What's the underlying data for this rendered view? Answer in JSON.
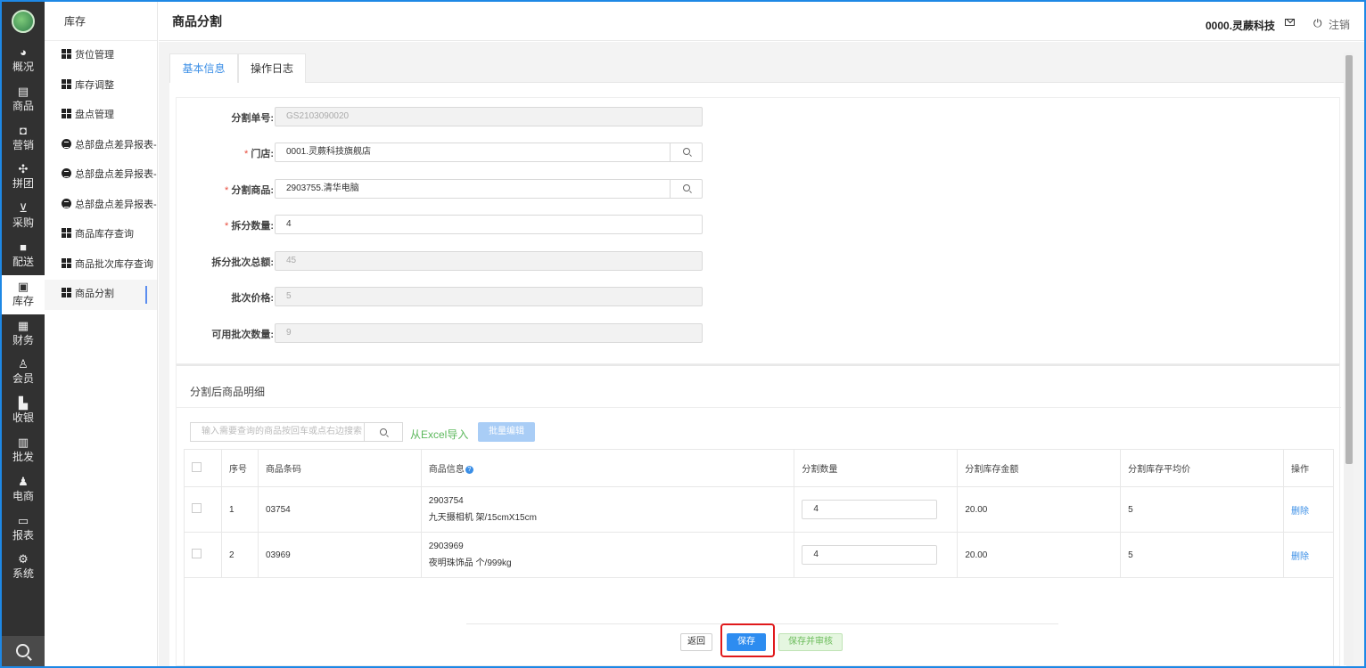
{
  "rail": {
    "items": [
      {
        "label": "概况",
        "icon": "dashboard-icon",
        "glyph": "◕"
      },
      {
        "label": "商品",
        "icon": "document-icon",
        "glyph": "▤"
      },
      {
        "label": "营销",
        "icon": "bag-icon",
        "glyph": "◘"
      },
      {
        "label": "拼团",
        "icon": "cluster-icon",
        "glyph": "✣"
      },
      {
        "label": "采购",
        "icon": "cart-icon",
        "glyph": "⊻"
      },
      {
        "label": "配送",
        "icon": "truck-icon",
        "glyph": "■"
      },
      {
        "label": "库存",
        "icon": "box-icon",
        "glyph": "▣"
      },
      {
        "label": "财务",
        "icon": "money-icon",
        "glyph": "▦"
      },
      {
        "label": "会员",
        "icon": "user-icon",
        "glyph": "♙"
      },
      {
        "label": "收银",
        "icon": "register-icon",
        "glyph": "▙"
      },
      {
        "label": "批发",
        "icon": "clipboard-icon",
        "glyph": "▥"
      },
      {
        "label": "电商",
        "icon": "person-icon",
        "glyph": "♟"
      },
      {
        "label": "报表",
        "icon": "monitor-icon",
        "glyph": "▭"
      },
      {
        "label": "系统",
        "icon": "gear-icon",
        "glyph": "⚙"
      }
    ],
    "active_index": 6
  },
  "submenu": {
    "title": "库存",
    "items": [
      {
        "label": "货位管理",
        "icon": "grid-icon"
      },
      {
        "label": "库存调整",
        "icon": "grid-icon"
      },
      {
        "label": "盘点管理",
        "icon": "grid-icon"
      },
      {
        "label": "总部盘点差异报表-...",
        "icon": "database-icon"
      },
      {
        "label": "总部盘点差异报表-...",
        "icon": "database-icon"
      },
      {
        "label": "总部盘点差异报表-...",
        "icon": "database-icon"
      },
      {
        "label": "商品库存查询",
        "icon": "grid-icon"
      },
      {
        "label": "商品批次库存查询",
        "icon": "grid-icon"
      },
      {
        "label": "商品分割",
        "icon": "grid-icon"
      }
    ],
    "active_index": 8
  },
  "header": {
    "title": "商品分割",
    "company": "0000.灵蕨科技",
    "logout": "注销",
    "power_glyph": "⏻"
  },
  "tabs": [
    "基本信息",
    "操作日志"
  ],
  "form": {
    "split_no": {
      "label": "分割单号:",
      "value": "GS2103090020"
    },
    "store": {
      "label": "门店:",
      "value": "0001.灵蕨科技旗舰店"
    },
    "split_item": {
      "label": "分割商品:",
      "value": "2903755.清华电脑"
    },
    "split_qty": {
      "label": "拆分数量:",
      "value": "4"
    },
    "batch_total": {
      "label": "拆分批次总额:",
      "value": "45"
    },
    "batch_price": {
      "label": "批次价格:",
      "value": "5"
    },
    "available_qty": {
      "label": "可用批次数量:",
      "value": "9"
    }
  },
  "detail": {
    "title": "分割后商品明细",
    "search_placeholder": "输入需要查询的商品按回车或点右边搜索",
    "excel_import": "从Excel导入",
    "batch_edit": "批量编辑",
    "columns": [
      "序号",
      "商品条码",
      "商品信息",
      "分割数量",
      "分割库存金额",
      "分割库存平均价",
      "操作"
    ],
    "rows": [
      {
        "seq": "1",
        "barcode": "03754",
        "code": "2903754",
        "desc": "九天摄相机 架/15cmX15cm",
        "qty": "4",
        "amount": "20.00",
        "avg": "5",
        "action": "删除"
      },
      {
        "seq": "2",
        "barcode": "03969",
        "code": "2903969",
        "desc": "夜明珠饰品 个/999kg",
        "qty": "4",
        "amount": "20.00",
        "avg": "5",
        "action": "删除"
      }
    ]
  },
  "footer": {
    "back": "返回",
    "save": "保存",
    "save_audit": "保存并审核"
  },
  "colors": {
    "accent": "#2d8cf0",
    "required": "#e84c3d",
    "excel_green": "#5cb85c",
    "highlight": "#e0191b"
  }
}
